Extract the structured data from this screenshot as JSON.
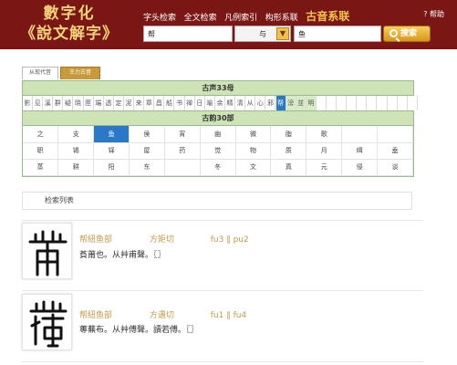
{
  "header": {
    "logo_line1": "數字化",
    "logo_line2": "《說文解字》",
    "nav": [
      "字头检索",
      "全文检索",
      "凡例索引",
      "构形系联"
    ],
    "nav_active": "古音系联",
    "help": "? 帮助"
  },
  "search": {
    "left_value": "帮",
    "select_value": "与",
    "right_value": "鱼",
    "button": "搜索"
  },
  "tabs": [
    "从现代音",
    "王力古音"
  ],
  "sheng": {
    "title": "古声33母",
    "cells": [
      "影",
      "见",
      "溪",
      "群",
      "疑",
      "晓",
      "匣",
      "端",
      "透",
      "定",
      "泥",
      "来",
      "章",
      "昌",
      "船",
      "书",
      "禅",
      "日",
      "喻",
      "余",
      "精",
      "清",
      "从",
      "心",
      "邪",
      "帮",
      "滂",
      "並",
      "明"
    ],
    "selected": "帮"
  },
  "yun": {
    "title": "古韵30部",
    "rows": [
      [
        "之",
        "支",
        "鱼",
        "侯",
        "宵",
        "幽",
        "微",
        "脂",
        "歌",
        "",
        ""
      ],
      [
        "职",
        "锡",
        "铎",
        "屋",
        "药",
        "觉",
        "物",
        "质",
        "月",
        "缉",
        "盍"
      ],
      [
        "蒸",
        "耕",
        "阳",
        "东",
        "",
        "冬",
        "文",
        "真",
        "元",
        "侵",
        "谈"
      ]
    ],
    "selected": "鱼"
  },
  "list_title": "检索列表",
  "results": [
    {
      "char": "莆",
      "parts": [
        "帮紐鱼部",
        "方矩切",
        "fu3 ‖ pu2"
      ],
      "definition": "萯莆也。从艸甫聲。〖〗"
    },
    {
      "char": "蒪",
      "parts": [
        "帮紐鱼部",
        "方遇切",
        "fu1 ‖ fu4"
      ],
      "definition": "蒪蕪布。从艸傅聲。讀若傅。〖〗"
    }
  ]
}
